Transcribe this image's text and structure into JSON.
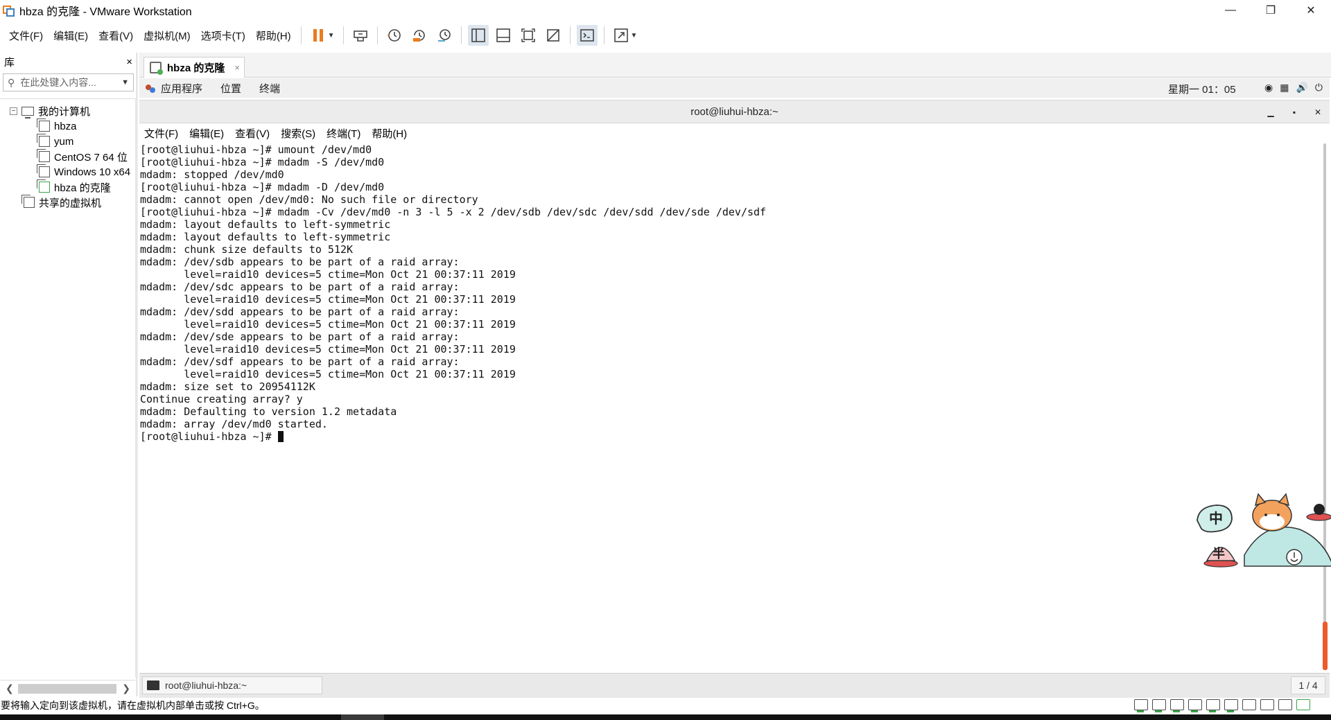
{
  "window": {
    "title": "hbza 的克隆 - VMware Workstation",
    "controls": [
      "minimize",
      "restore",
      "close"
    ]
  },
  "menubar": {
    "items": [
      "文件(F)",
      "编辑(E)",
      "查看(V)",
      "虚拟机(M)",
      "选项卡(T)",
      "帮助(H)"
    ]
  },
  "toolbar": {
    "icons": [
      "pause-icon",
      "send-ctrl-alt-del-icon",
      "snapshot-icon",
      "revert-snapshot-icon",
      "snapshot-manager-icon",
      "show-library-icon",
      "thumbnail-bar-icon",
      "full-screen-icon",
      "unity-icon",
      "console-icon",
      "stretch-icon"
    ],
    "accent": "#e97b1f"
  },
  "library": {
    "title": "库",
    "close": "×",
    "search_placeholder": "在此处键入内容...",
    "tree": {
      "root": "我的计算机",
      "vms": [
        "hbza",
        "yum",
        "CentOS 7 64 位",
        "Windows 10 x64",
        "hbza 的克隆"
      ],
      "shared": "共享的虚拟机"
    }
  },
  "tab": {
    "label": "hbza 的克隆",
    "close": "×"
  },
  "guest": {
    "topbar": {
      "items": [
        "应用程序",
        "位置",
        "终端"
      ],
      "clock": "星期一 01：05"
    },
    "terminal": {
      "title": "root@liuhui-hbza:~",
      "menu": [
        "文件(F)",
        "编辑(E)",
        "查看(V)",
        "搜索(S)",
        "终端(T)",
        "帮助(H)"
      ],
      "lines": [
        "[root@liuhui-hbza ~]# umount /dev/md0",
        "[root@liuhui-hbza ~]# mdadm -S /dev/md0",
        "mdadm: stopped /dev/md0",
        "[root@liuhui-hbza ~]# mdadm -D /dev/md0",
        "mdadm: cannot open /dev/md0: No such file or directory",
        "[root@liuhui-hbza ~]# mdadm -Cv /dev/md0 -n 3 -l 5 -x 2 /dev/sdb /dev/sdc /dev/sdd /dev/sde /dev/sdf",
        "mdadm: layout defaults to left-symmetric",
        "mdadm: layout defaults to left-symmetric",
        "mdadm: chunk size defaults to 512K",
        "mdadm: /dev/sdb appears to be part of a raid array:",
        "       level=raid10 devices=5 ctime=Mon Oct 21 00:37:11 2019",
        "mdadm: /dev/sdc appears to be part of a raid array:",
        "       level=raid10 devices=5 ctime=Mon Oct 21 00:37:11 2019",
        "mdadm: /dev/sdd appears to be part of a raid array:",
        "       level=raid10 devices=5 ctime=Mon Oct 21 00:37:11 2019",
        "mdadm: /dev/sde appears to be part of a raid array:",
        "       level=raid10 devices=5 ctime=Mon Oct 21 00:37:11 2019",
        "mdadm: /dev/sdf appears to be part of a raid array:",
        "       level=raid10 devices=5 ctime=Mon Oct 21 00:37:11 2019",
        "mdadm: size set to 20954112K",
        "Continue creating array? y",
        "mdadm: Defaulting to version 1.2 metadata",
        "mdadm: array /dev/md0 started."
      ],
      "prompt": "[root@liuhui-hbza ~]# "
    },
    "mascot": {
      "bubble": "中",
      "badge": "半"
    },
    "taskbar": {
      "item": "root@liuhui-hbza:~",
      "workspace": "1 / 4"
    }
  },
  "statusbar": {
    "text": "要将输入定向到该虚拟机，请在虚拟机内部单击或按 Ctrl+G。"
  }
}
